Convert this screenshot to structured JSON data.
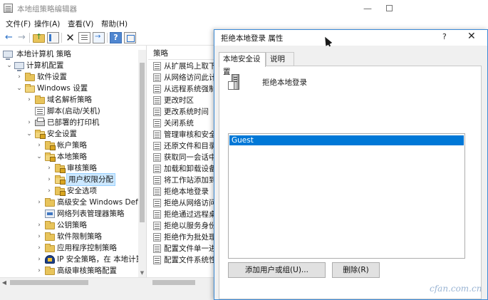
{
  "window": {
    "title": "本地组策略编辑器",
    "minimize_glyph": "—"
  },
  "menu": [
    {
      "label": "文件(F)"
    },
    {
      "label": "操作(A)"
    },
    {
      "label": "查看(V)"
    },
    {
      "label": "帮助(H)"
    }
  ],
  "toolbar": {
    "icons": [
      "back-arrow-icon",
      "forward-arrow-icon",
      "folder-up-icon",
      "show-tree-icon",
      "delete-icon",
      "properties-sheet-icon",
      "export-list-icon",
      "help-icon",
      "show-properties-icon"
    ],
    "back_glyph": "←",
    "forward_glyph": "→",
    "delete_glyph": "✕",
    "help_glyph": "?"
  },
  "tree": {
    "nodes": [
      {
        "label": "本地计算机 策略",
        "icon": "pc-icon"
      },
      {
        "label": "计算机配置",
        "icon": "pc-icon",
        "chevron": "⌄"
      },
      {
        "label": "软件设置",
        "icon": "folder-icon",
        "chevron": "›"
      },
      {
        "label": "Windows 设置",
        "icon": "folder-icon",
        "chevron": "⌄"
      },
      {
        "label": "域名解析策略",
        "icon": "folder-icon",
        "chevron": "›"
      },
      {
        "label": "脚本(启动/关机)",
        "icon": "script-icon"
      },
      {
        "label": "已部署的打印机",
        "icon": "printer-icon",
        "chevron": "›"
      },
      {
        "label": "安全设置",
        "icon": "folder-icon",
        "chevron": "⌄"
      },
      {
        "label": "帐户策略",
        "icon": "folder-icon",
        "chevron": "›"
      },
      {
        "label": "本地策略",
        "icon": "folder-icon",
        "chevron": "⌄"
      },
      {
        "label": "审核策略",
        "icon": "folder-icon",
        "chevron": "›"
      },
      {
        "label": "用户权限分配",
        "icon": "folder-icon",
        "chevron": "›",
        "selected": true
      },
      {
        "label": "安全选项",
        "icon": "folder-icon",
        "chevron": "›"
      },
      {
        "label": "高级安全 Windows Defe",
        "icon": "folder-icon",
        "chevron": "›"
      },
      {
        "label": "网络列表管理器策略",
        "icon": "network-icon"
      },
      {
        "label": "公钥策略",
        "icon": "folder-icon",
        "chevron": "›"
      },
      {
        "label": "软件限制策略",
        "icon": "folder-icon",
        "chevron": "›"
      },
      {
        "label": "应用程序控制策略",
        "icon": "folder-icon",
        "chevron": "›"
      },
      {
        "label": "IP 安全策略，在 本地计算",
        "icon": "ipsec-icon",
        "chevron": "›"
      },
      {
        "label": "高级审核策略配置",
        "icon": "folder-icon",
        "chevron": "›"
      }
    ],
    "scroll_down_glyph": "▼"
  },
  "list": {
    "header": "策略",
    "items": [
      {
        "label": "从扩展坞上取下计"
      },
      {
        "label": "从网络访问此计算"
      },
      {
        "label": "从远程系统强制关"
      },
      {
        "label": "更改时区"
      },
      {
        "label": "更改系统时间"
      },
      {
        "label": "关闭系统"
      },
      {
        "label": "管理审核和安全日"
      },
      {
        "label": "还原文件和目录"
      },
      {
        "label": "获取同一会话中另"
      },
      {
        "label": "加载和卸载设备驱"
      },
      {
        "label": "将工作站添加到域"
      },
      {
        "label": "拒绝本地登录"
      },
      {
        "label": "拒绝从网络访问这"
      },
      {
        "label": "拒绝通过远程桌面"
      },
      {
        "label": "拒绝以服务身份登"
      },
      {
        "label": "拒绝作为批处理作"
      },
      {
        "label": "配置文件单一进程"
      },
      {
        "label": "配置文件系统性能"
      }
    ],
    "hscroll_left_glyph": "◀"
  },
  "dialog": {
    "title": "拒绝本地登录 属性",
    "help_glyph": "?",
    "close_glyph": "✕",
    "tabs": [
      {
        "label": "本地安全设置",
        "active": true
      },
      {
        "label": "说明",
        "active": false
      }
    ],
    "policy_name": "拒绝本地登录",
    "users": [
      "Guest"
    ],
    "buttons": {
      "add": "添加用户或组(U)...",
      "remove": "删除(R)"
    }
  },
  "watermark": "cfan.com.cn",
  "colors": {
    "selection": "#0078d7",
    "tree_selection": "#cce8ff",
    "dialog_border": "#3b8ad6"
  }
}
